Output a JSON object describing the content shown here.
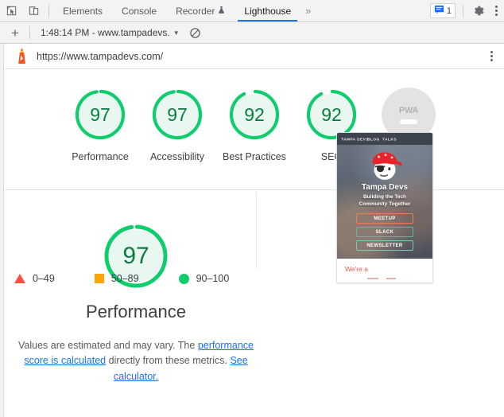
{
  "devtools": {
    "icons": {
      "inspect": "inspect-cursor-icon",
      "device": "device-toolbar-icon",
      "settings": "gear-icon",
      "more": "more-vertical-icon",
      "issues": "issues-message-icon"
    },
    "tabs": [
      {
        "label": "Elements",
        "active": false
      },
      {
        "label": "Console",
        "active": false
      },
      {
        "label": "Recorder",
        "active": false,
        "badge": "experiment-flask-icon"
      },
      {
        "label": "Lighthouse",
        "active": true
      }
    ],
    "overflow_label": "»",
    "issues_count": "1"
  },
  "lighthouse_toolbar": {
    "add_label": "+",
    "run_selected": "1:48:14 PM - www.tampadevs.",
    "caret": "▼",
    "clear_icon": "clear-all-icon"
  },
  "report_header": {
    "logo_icon": "lighthouse-logo-icon",
    "url": "https://www.tampadevs.com/",
    "menu_icon": "more-vertical-icon"
  },
  "scores": [
    {
      "label": "Performance",
      "value": "97",
      "state": "pass"
    },
    {
      "label": "Accessibility",
      "value": "97",
      "state": "pass"
    },
    {
      "label": "Best Practices",
      "value": "92",
      "state": "pass"
    },
    {
      "label": "SEO",
      "value": "92",
      "state": "pass"
    },
    {
      "label": "PWA",
      "value": "PWA",
      "state": "not-applicable"
    }
  ],
  "performance_section": {
    "score": "97",
    "title": "Performance",
    "description_part1": "Values are estimated and may vary. The ",
    "link1": "performance score is calculated",
    "description_part2": " directly from these metrics. ",
    "link2": "See calculator."
  },
  "legend": [
    {
      "shape": "triangle",
      "range": "0–49",
      "color": "#ff4e42"
    },
    {
      "shape": "square",
      "range": "50–89",
      "color": "#ffa400"
    },
    {
      "shape": "circle",
      "range": "90–100",
      "color": "#0cce6b"
    }
  ],
  "thumbnail": {
    "nav": [
      "TAMPA DEVS",
      "BLOG",
      "TALKS"
    ],
    "title": "Tampa Devs",
    "subtitle": "Building the Tech\nCommunity Together",
    "buttons": [
      "MEETUP",
      "SLACK",
      "NEWSLETTER"
    ],
    "footer_text": "We're a"
  },
  "colors": {
    "pass_arc": "#0cce6b",
    "pass_fill": "#e8f8f0",
    "pass_text": "#0b7c3f",
    "average": "#ffa400",
    "fail": "#ff4e42",
    "na_fill": "#e3e3e3",
    "link": "#1a73e8",
    "active_tab_underline": "#1a73e8",
    "lighthouse_logo": "#f4511e"
  }
}
